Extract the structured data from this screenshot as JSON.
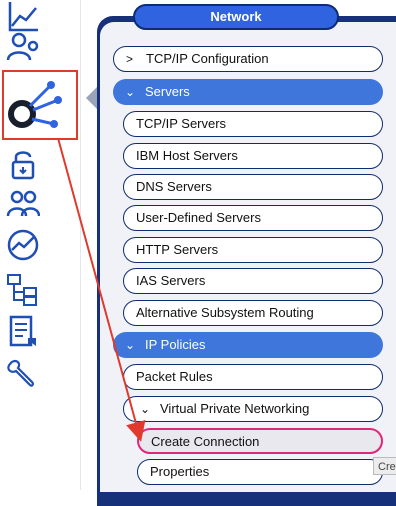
{
  "menu": {
    "title": "Network",
    "items": [
      {
        "label": "TCP/IP Configuration",
        "chevron": ">"
      },
      {
        "label": "Servers",
        "chevron": "⌄"
      },
      {
        "label": "TCP/IP Servers"
      },
      {
        "label": "IBM Host Servers"
      },
      {
        "label": "DNS Servers"
      },
      {
        "label": "User-Defined Servers"
      },
      {
        "label": "HTTP Servers"
      },
      {
        "label": "IAS Servers"
      },
      {
        "label": "Alternative Subsystem Routing"
      },
      {
        "label": "IP Policies",
        "chevron": "⌄"
      },
      {
        "label": "Packet Rules"
      },
      {
        "label": "Virtual Private Networking",
        "chevron": "⌄"
      },
      {
        "label": "Create Connection"
      },
      {
        "label": "Properties"
      }
    ]
  },
  "tooltip": {
    "text": "Cre"
  },
  "rail": {
    "icons": [
      "chart-icon",
      "user-settings-icon",
      "network-icon",
      "lock-icon",
      "users-icon",
      "performance-icon",
      "file-system-icon",
      "journal-icon",
      "tools-icon"
    ]
  },
  "colors": {
    "accent": "#2f63e0",
    "frame": "#0f2b72",
    "highlight": "#e03a2e"
  }
}
